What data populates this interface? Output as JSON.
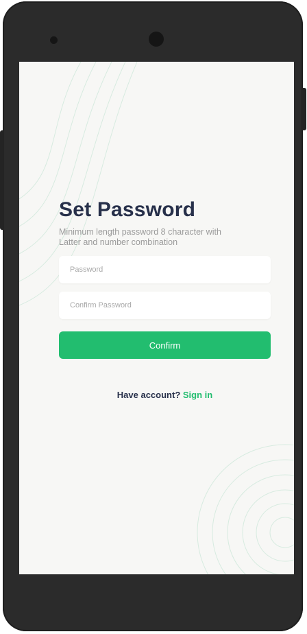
{
  "screen": {
    "title": "Set Password",
    "subtitle": "Minimum length password 8 character with Latter and number combination",
    "password_field": {
      "value": "",
      "placeholder": "Password"
    },
    "confirm_password_field": {
      "value": "",
      "placeholder": "Confirm Password"
    },
    "confirm_button": "Confirm",
    "footer": {
      "prompt": "Have account?",
      "link": "Sign in"
    }
  },
  "colors": {
    "accent": "#22bd6f",
    "title": "#27304a",
    "background": "#f7f7f5",
    "device_frame": "#2b2b2b"
  }
}
